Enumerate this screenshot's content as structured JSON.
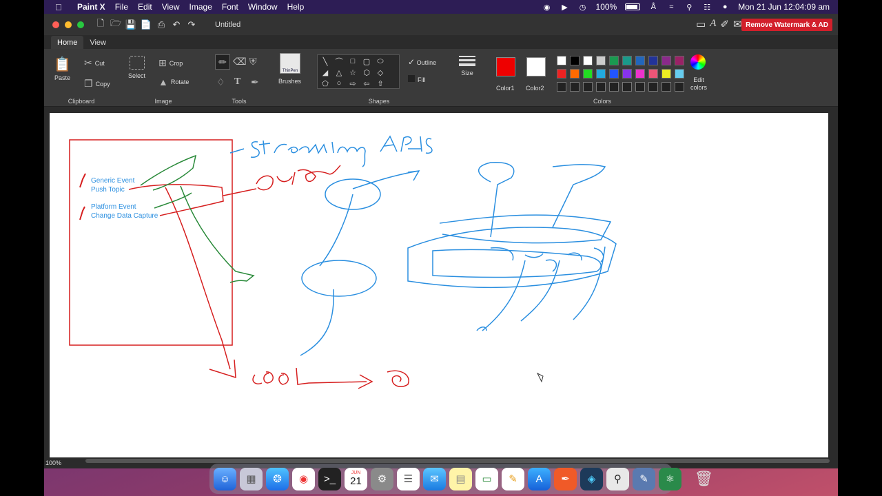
{
  "menubar": {
    "app_name": "Paint X",
    "menus": [
      "File",
      "Edit",
      "View",
      "Image",
      "Font",
      "Window",
      "Help"
    ],
    "battery": "100%",
    "datetime": "Mon 21 Jun  12:04:09 am"
  },
  "window": {
    "title": "Untitled",
    "remove_watermark_label": "Remove Watermark & AD"
  },
  "tabs": [
    {
      "label": "Home",
      "active": true
    },
    {
      "label": "View",
      "active": false
    }
  ],
  "ribbon": {
    "clipboard": {
      "label": "Clipboard",
      "paste": "Paste",
      "cut": "Cut",
      "copy": "Copy"
    },
    "image": {
      "label": "Image",
      "select": "Select",
      "crop": "Crop",
      "rotate": "Rotate"
    },
    "tools": {
      "label": "Tools"
    },
    "brushes": {
      "label": "Brushes",
      "brush_name": "ThinPen"
    },
    "shapes": {
      "label": "Shapes",
      "outline": "Outline",
      "fill": "Fill"
    },
    "size": {
      "label": "Size"
    },
    "colors": {
      "label": "Colors",
      "color1_label": "Color1",
      "color2_label": "Color2",
      "edit_label": "Edit colors",
      "color1": "#ee0000",
      "color2": "#ffffff",
      "row1": [
        "#ffffff",
        "#000000",
        "#ffffff",
        "#cccccc",
        "#1a9a50",
        "#1a9a8a",
        "#2266bb",
        "#223399",
        "#8a2a8a",
        "#9a2266"
      ],
      "row2": [
        "#ee2222",
        "#ff6a00",
        "#22dd22",
        "#22aadd",
        "#2255ff",
        "#8833ee",
        "#ee33cc",
        "#ee5577",
        "#eeee22",
        "#66ccee"
      ]
    }
  },
  "canvas": {
    "labels": {
      "generic_event": "Generic Event",
      "push_topic": "Push Topic",
      "platform_event": "Platform Event",
      "change_data_capture": "Change Data Capture"
    },
    "handwriting": {
      "title": "Streaming APIs",
      "data": "Data",
      "soql": "SOQL"
    }
  },
  "status": {
    "zoom": "100%"
  },
  "dock": {
    "calendar_month": "JUN",
    "calendar_day": "21"
  }
}
